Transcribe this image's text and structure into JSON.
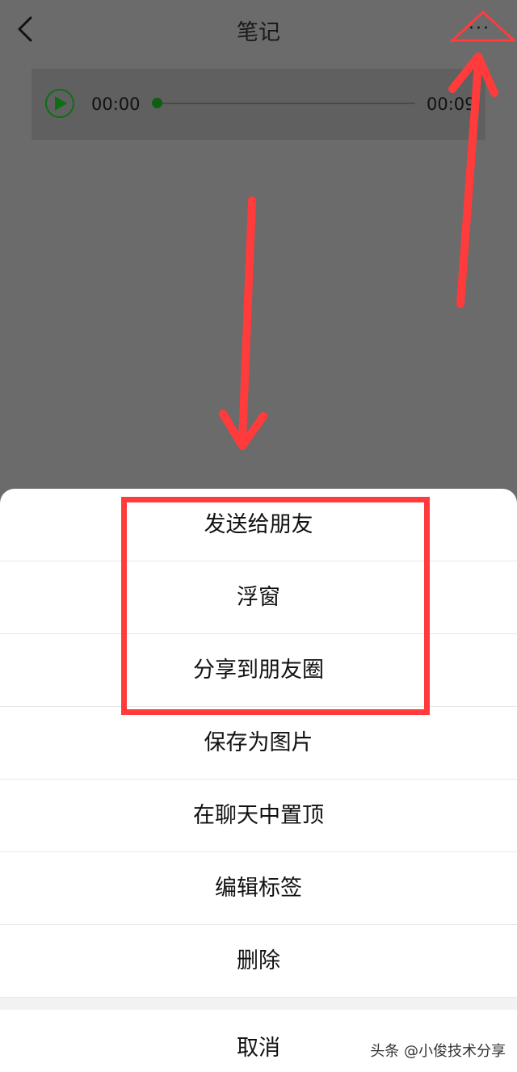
{
  "header": {
    "title": "笔记",
    "more_label": "···"
  },
  "player": {
    "time_start": "00:00",
    "time_end": "00:09",
    "progress_fraction": 0.0
  },
  "sheet": {
    "items": [
      {
        "label": "发送给朋友"
      },
      {
        "label": "浮窗"
      },
      {
        "label": "分享到朋友圈"
      },
      {
        "label": "保存为图片"
      },
      {
        "label": "在聊天中置顶"
      },
      {
        "label": "编辑标签"
      },
      {
        "label": "删除"
      }
    ],
    "cancel_label": "取消"
  },
  "watermark": "头条 @小俊技术分享",
  "colors": {
    "annotation": "#ff3b3b",
    "accent": "#0d6e14",
    "overlay": "#6b6b6b"
  }
}
